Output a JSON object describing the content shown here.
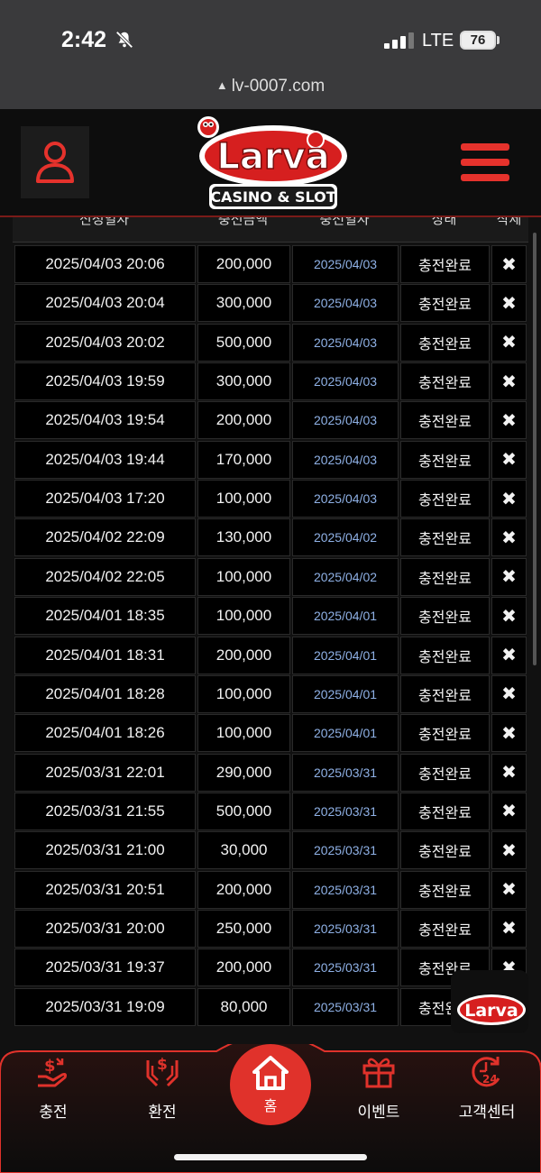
{
  "status": {
    "time": "2:42",
    "network": "LTE",
    "battery": "76"
  },
  "url": "lv-0007.com",
  "logo": {
    "brand": "Larva",
    "tagline": "CASINO & SLOT"
  },
  "table": {
    "headers": [
      "신청일자",
      "충전금액",
      "충전일자",
      "상태",
      "삭제"
    ],
    "rows": [
      {
        "requested": "2025/04/03 20:06",
        "amount": "200,000",
        "charged": "2025/04/03",
        "status": "충전완료"
      },
      {
        "requested": "2025/04/03 20:04",
        "amount": "300,000",
        "charged": "2025/04/03",
        "status": "충전완료"
      },
      {
        "requested": "2025/04/03 20:02",
        "amount": "500,000",
        "charged": "2025/04/03",
        "status": "충전완료"
      },
      {
        "requested": "2025/04/03 19:59",
        "amount": "300,000",
        "charged": "2025/04/03",
        "status": "충전완료"
      },
      {
        "requested": "2025/04/03 19:54",
        "amount": "200,000",
        "charged": "2025/04/03",
        "status": "충전완료"
      },
      {
        "requested": "2025/04/03 19:44",
        "amount": "170,000",
        "charged": "2025/04/03",
        "status": "충전완료"
      },
      {
        "requested": "2025/04/03 17:20",
        "amount": "100,000",
        "charged": "2025/04/03",
        "status": "충전완료"
      },
      {
        "requested": "2025/04/02 22:09",
        "amount": "130,000",
        "charged": "2025/04/02",
        "status": "충전완료"
      },
      {
        "requested": "2025/04/02 22:05",
        "amount": "100,000",
        "charged": "2025/04/02",
        "status": "충전완료"
      },
      {
        "requested": "2025/04/01 18:35",
        "amount": "100,000",
        "charged": "2025/04/01",
        "status": "충전완료"
      },
      {
        "requested": "2025/04/01 18:31",
        "amount": "200,000",
        "charged": "2025/04/01",
        "status": "충전완료"
      },
      {
        "requested": "2025/04/01 18:28",
        "amount": "100,000",
        "charged": "2025/04/01",
        "status": "충전완료"
      },
      {
        "requested": "2025/04/01 18:26",
        "amount": "100,000",
        "charged": "2025/04/01",
        "status": "충전완료"
      },
      {
        "requested": "2025/03/31 22:01",
        "amount": "290,000",
        "charged": "2025/03/31",
        "status": "충전완료"
      },
      {
        "requested": "2025/03/31 21:55",
        "amount": "500,000",
        "charged": "2025/03/31",
        "status": "충전완료"
      },
      {
        "requested": "2025/03/31 21:00",
        "amount": "30,000",
        "charged": "2025/03/31",
        "status": "충전완료"
      },
      {
        "requested": "2025/03/31 20:51",
        "amount": "200,000",
        "charged": "2025/03/31",
        "status": "충전완료"
      },
      {
        "requested": "2025/03/31 20:00",
        "amount": "250,000",
        "charged": "2025/03/31",
        "status": "충전완료"
      },
      {
        "requested": "2025/03/31 19:37",
        "amount": "200,000",
        "charged": "2025/03/31",
        "status": "충전완료"
      },
      {
        "requested": "2025/03/31 19:09",
        "amount": "80,000",
        "charged": "2025/03/31",
        "status": "충전완료"
      }
    ],
    "delete_symbol": "✖"
  },
  "nav": {
    "charge": "충전",
    "exchange": "환전",
    "home": "홈",
    "event": "이벤트",
    "support": "고객센터"
  },
  "colors": {
    "accent": "#e0322b",
    "date_link": "#8fb1e6"
  }
}
